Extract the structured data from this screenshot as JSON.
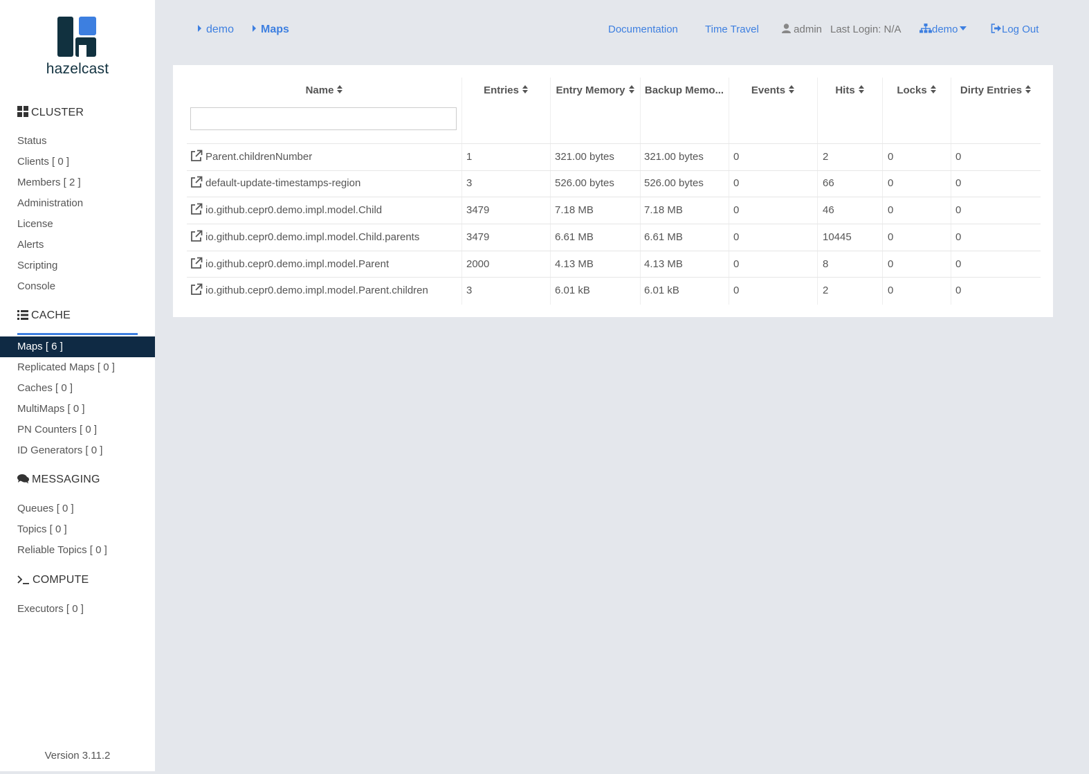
{
  "app": {
    "logo_text": "hazelcast",
    "version": "Version 3.11.2"
  },
  "sidebar": {
    "cluster": {
      "title": "CLUSTER",
      "items": [
        "Status",
        "Clients [ 0 ]",
        "Members [ 2 ]",
        "Administration",
        "License",
        "Alerts",
        "Scripting",
        "Console"
      ]
    },
    "cache": {
      "title": "CACHE",
      "active": "Maps [ 6 ]",
      "items": [
        "Replicated Maps [ 0 ]",
        "Caches [ 0 ]",
        "MultiMaps [ 0 ]",
        "PN Counters [ 0 ]",
        "ID Generators [ 0 ]"
      ]
    },
    "messaging": {
      "title": "MESSAGING",
      "items": [
        "Queues [ 0 ]",
        "Topics [ 0 ]",
        "Reliable Topics [ 0 ]"
      ]
    },
    "compute": {
      "title": "COMPUTE",
      "items": [
        "Executors [ 0 ]"
      ]
    }
  },
  "breadcrumb": [
    "demo",
    "Maps"
  ],
  "topnav": {
    "documentation": "Documentation",
    "time_travel": "Time Travel",
    "user": "admin",
    "last_login": "Last Login: N/A",
    "cluster": "demo",
    "logout": "Log Out"
  },
  "table": {
    "columns": [
      "Name",
      "Entries",
      "Entry Memory",
      "Backup Memo...",
      "Events",
      "Hits",
      "Locks",
      "Dirty Entries"
    ],
    "filter_value": "",
    "rows": [
      [
        "Parent.childrenNumber",
        "1",
        "321.00 bytes",
        "321.00 bytes",
        "0",
        "2",
        "0",
        "0"
      ],
      [
        "default-update-timestamps-region",
        "3",
        "526.00 bytes",
        "526.00 bytes",
        "0",
        "66",
        "0",
        "0"
      ],
      [
        "io.github.cepr0.demo.impl.model.Child",
        "3479",
        "7.18 MB",
        "7.18 MB",
        "0",
        "46",
        "0",
        "0"
      ],
      [
        "io.github.cepr0.demo.impl.model.Child.parents",
        "3479",
        "6.61 MB",
        "6.61 MB",
        "0",
        "10445",
        "0",
        "0"
      ],
      [
        "io.github.cepr0.demo.impl.model.Parent",
        "2000",
        "4.13 MB",
        "4.13 MB",
        "0",
        "8",
        "0",
        "0"
      ],
      [
        "io.github.cepr0.demo.impl.model.Parent.children",
        "3",
        "6.01 kB",
        "6.01 kB",
        "0",
        "2",
        "0",
        "0"
      ]
    ]
  },
  "colors": {
    "accent": "#3d7fe0",
    "sidebar_active": "#0f2a44",
    "logo_dark": "#11313f",
    "background": "#e4e7ec"
  }
}
